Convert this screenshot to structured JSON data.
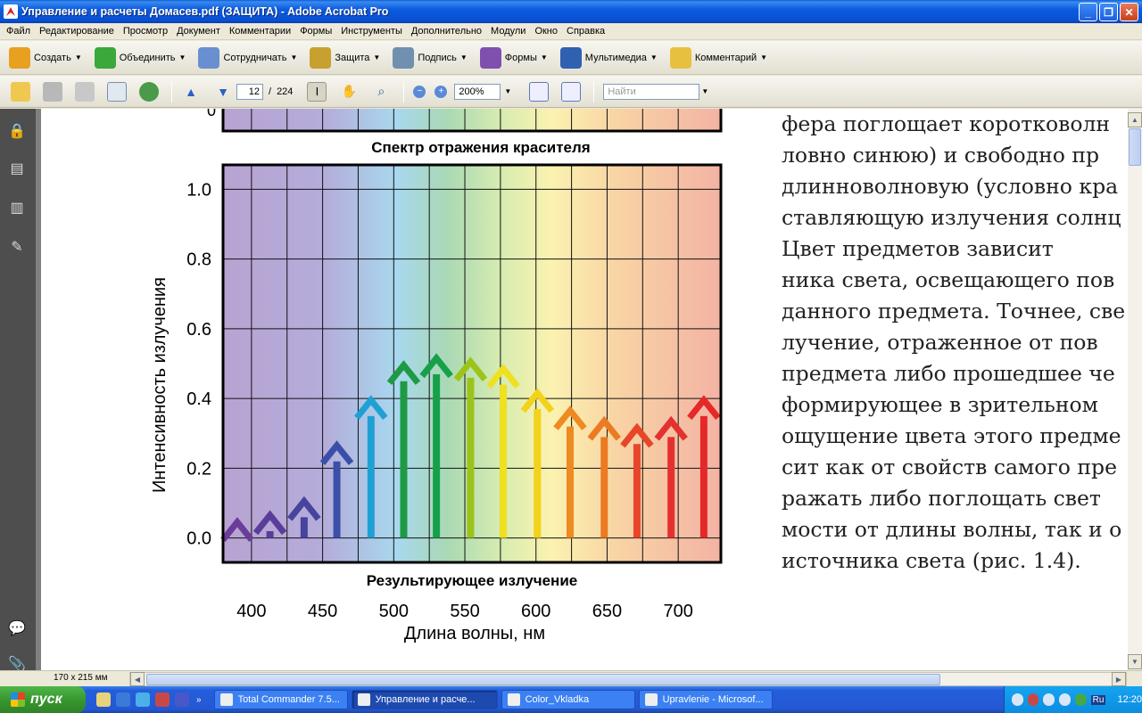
{
  "window": {
    "title": "Управление и расчеты Домасев.pdf (ЗАЩИТА) - Adobe Acrobat Pro",
    "min_glyph": "_",
    "max_glyph": "❐",
    "close_glyph": "✕"
  },
  "menu": [
    "Файл",
    "Редактирование",
    "Просмотр",
    "Документ",
    "Комментарии",
    "Формы",
    "Инструменты",
    "Дополнительно",
    "Модули",
    "Окно",
    "Справка"
  ],
  "toolbar1": [
    {
      "label": "Создать",
      "icon": "create-icon",
      "color": "#e8a020"
    },
    {
      "label": "Объединить",
      "icon": "combine-icon",
      "color": "#3aa83a"
    },
    {
      "label": "Сотрудничать",
      "icon": "collaborate-icon",
      "color": "#6a8fd0"
    },
    {
      "label": "Защита",
      "icon": "lock-icon",
      "color": "#c8a030"
    },
    {
      "label": "Подпись",
      "icon": "pen-icon",
      "color": "#7090b0"
    },
    {
      "label": "Формы",
      "icon": "forms-icon",
      "color": "#8050b0"
    },
    {
      "label": "Мультимедиа",
      "icon": "multimedia-icon",
      "color": "#3060b0"
    },
    {
      "label": "Комментарий",
      "icon": "comment-icon",
      "color": "#e8c040"
    }
  ],
  "toolbar2": {
    "page_current": "12",
    "page_separator": "/",
    "page_total": "224",
    "zoom": "200%",
    "find_placeholder": "Найти"
  },
  "figure": {
    "top_caption": "Спектр отражения красителя",
    "top_zero_label": "0",
    "bottom_caption": "Результирующее излучение",
    "ylabel": "Интенсивность излучения",
    "xlabel": "Длина волны, нм"
  },
  "chart_data": {
    "type": "bar",
    "title": "Результирующее излучение",
    "xlabel": "Длина волны, нм",
    "ylabel": "Интенсивность излучения",
    "xlim": [
      380,
      730
    ],
    "ylim": [
      -0.07,
      1.07
    ],
    "x_ticks": [
      "400",
      "450",
      "500",
      "550",
      "600",
      "650",
      "700"
    ],
    "y_ticks": [
      "0.0",
      "0.2",
      "0.4",
      "0.6",
      "0.8",
      "1.0"
    ],
    "grid": true,
    "x": [
      390,
      413,
      437,
      460,
      484,
      507,
      530,
      554,
      577,
      601,
      624,
      648,
      671,
      695,
      718
    ],
    "values": [
      0.02,
      0.04,
      0.08,
      0.24,
      0.37,
      0.47,
      0.49,
      0.48,
      0.46,
      0.39,
      0.34,
      0.31,
      0.29,
      0.31,
      0.37
    ],
    "arrow_colors": [
      "#6a3d9a",
      "#5a3d9a",
      "#47449e",
      "#3b4fa8",
      "#1fa0d4",
      "#1e9a45",
      "#16a04a",
      "#9cc31a",
      "#f0e020",
      "#f2d21a",
      "#ee8a22",
      "#ec7a22",
      "#e8462a",
      "#e53030",
      "#e52828"
    ]
  },
  "page_text": [
    "фера поглощает коротковолн",
    "ловно синюю) и свободно пр",
    "длинноволновую (условно кра",
    "ставляющую излучения солнц",
    "    Цвет предметов зависит",
    "ника света, освещающего пов",
    "данного предмета. Точнее, све",
    "лучение, отраженное от пов",
    "предмета либо прошедшее че",
    "формирующее в зрительном",
    "ощущение цвета этого предме",
    "сит как от свойств самого пре",
    "ражать либо поглощать свет",
    "мости от длины волны, так и о",
    "источника света (рис. 1.4)."
  ],
  "status": {
    "page_size": "170 x 215 мм"
  },
  "taskbar": {
    "start": "пуск",
    "tasks": [
      {
        "label": "Total Commander 7.5...",
        "active": false
      },
      {
        "label": "Управление и расче...",
        "active": true
      },
      {
        "label": "Color_Vkladka",
        "active": false
      },
      {
        "label": "Upravlenie - Microsof...",
        "active": false
      }
    ],
    "lang": "Ru",
    "clock": "12:20"
  }
}
